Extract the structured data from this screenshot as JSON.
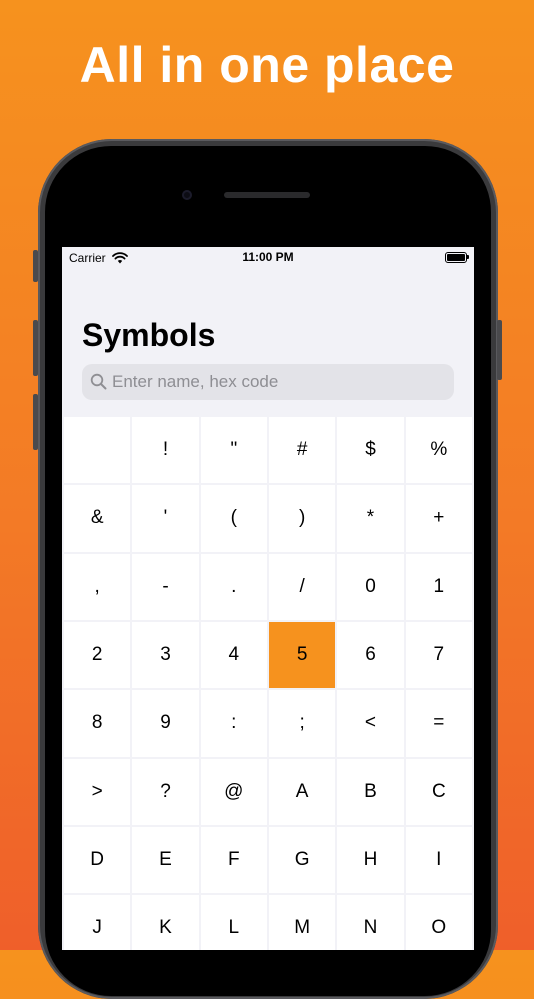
{
  "headline": "All in one place",
  "status_bar": {
    "carrier": "Carrier",
    "time": "11:00 PM"
  },
  "page_title": "Symbols",
  "search": {
    "placeholder": "Enter name, hex code",
    "value": ""
  },
  "colors": {
    "accent": "#f6921e",
    "background": "#f2f2f7",
    "cell": "#ffffff"
  },
  "symbols": [
    " ",
    "!",
    "\"",
    "#",
    "$",
    "%",
    "&",
    "'",
    "(",
    ")",
    "*",
    "+",
    ",",
    "-",
    ".",
    "/",
    "0",
    "1",
    "2",
    "3",
    "4",
    "5",
    "6",
    "7",
    "8",
    "9",
    ":",
    ";",
    "<",
    "=",
    ">",
    "?",
    "@",
    "A",
    "B",
    "C",
    "D",
    "E",
    "F",
    "G",
    "H",
    "I",
    "J",
    "K",
    "L",
    "M",
    "N",
    "O"
  ],
  "selected_symbol": "5"
}
